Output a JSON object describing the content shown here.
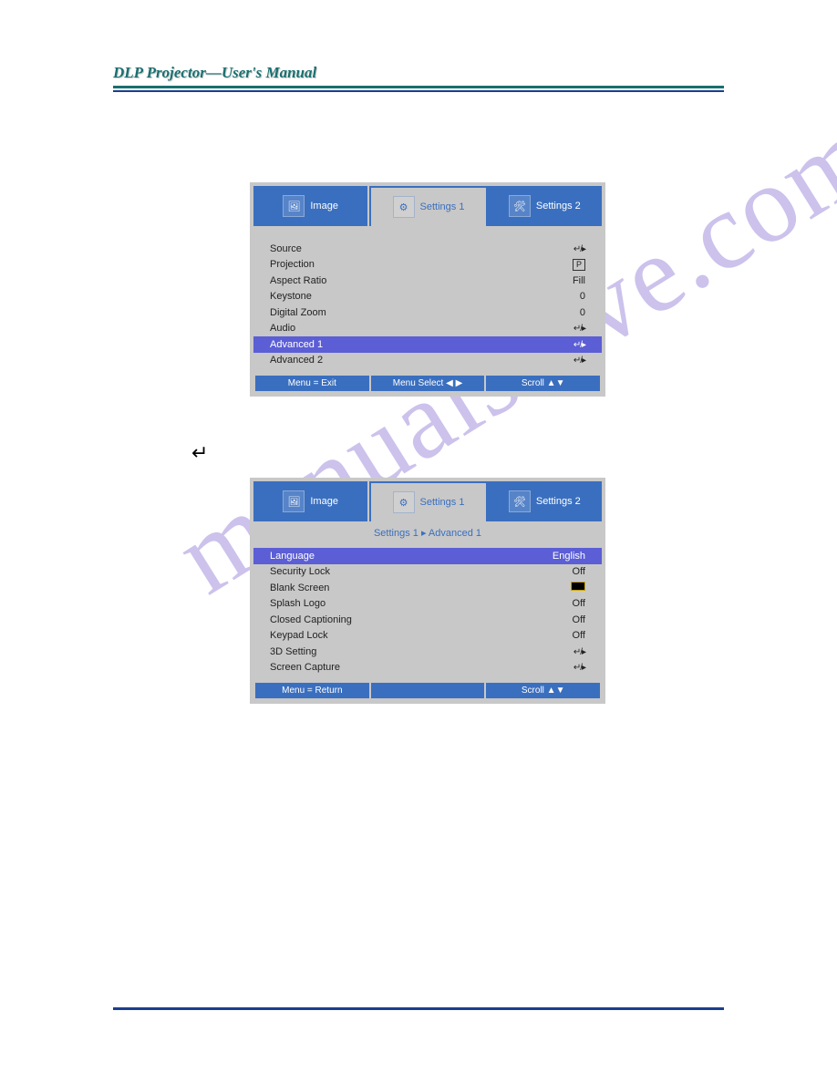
{
  "header": {
    "title": "DLP Projector—User's Manual"
  },
  "watermark": "manualshive.com",
  "tabs": {
    "image": "Image",
    "settings1": "Settings 1",
    "settings2": "Settings 2"
  },
  "osd1": {
    "rows": [
      {
        "label": "Source",
        "value_type": "enter"
      },
      {
        "label": "Projection",
        "value_type": "pbox",
        "value": "P"
      },
      {
        "label": "Aspect Ratio",
        "value_type": "text",
        "value": "Fill"
      },
      {
        "label": "Keystone",
        "value_type": "text",
        "value": "0"
      },
      {
        "label": "Digital Zoom",
        "value_type": "text",
        "value": "0"
      },
      {
        "label": "Audio",
        "value_type": "enter"
      },
      {
        "label": "Advanced 1",
        "value_type": "enter",
        "selected": true
      },
      {
        "label": "Advanced 2",
        "value_type": "enter"
      }
    ],
    "nav": {
      "left": "Menu = Exit",
      "mid": "Menu Select ◀ ▶",
      "right": "Scroll ▲▼"
    }
  },
  "osd2": {
    "breadcrumb": "Settings 1 ▸ Advanced 1",
    "rows": [
      {
        "label": "Language",
        "value_type": "text",
        "value": "English",
        "selected": true
      },
      {
        "label": "Security Lock",
        "value_type": "text",
        "value": "Off"
      },
      {
        "label": "Blank Screen",
        "value_type": "blackbox"
      },
      {
        "label": "Splash Logo",
        "value_type": "text",
        "value": "Off"
      },
      {
        "label": "Closed Captioning",
        "value_type": "text",
        "value": "Off"
      },
      {
        "label": "Keypad Lock",
        "value_type": "text",
        "value": "Off"
      },
      {
        "label": "3D Setting",
        "value_type": "enter"
      },
      {
        "label": "Screen Capture",
        "value_type": "enter"
      }
    ],
    "nav": {
      "left": "Menu = Return",
      "mid": "",
      "right": "Scroll ▲▼"
    }
  }
}
